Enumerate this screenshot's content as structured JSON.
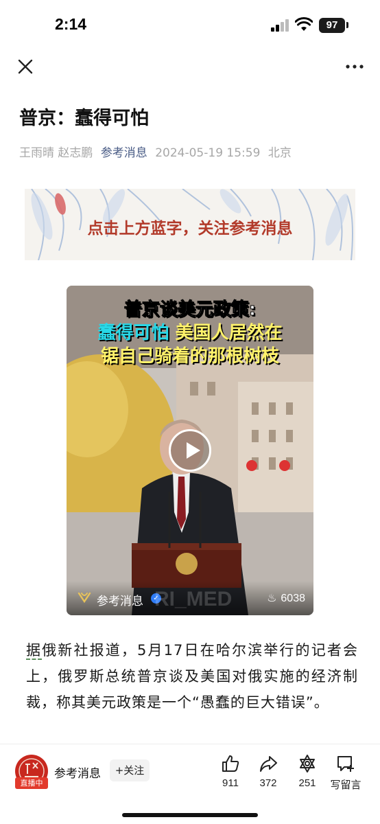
{
  "status_bar": {
    "time": "2:14",
    "battery": "97"
  },
  "nav": {
    "close_icon": "close-icon",
    "more_icon": "more-horizontal-icon"
  },
  "article": {
    "title": "普京：蠢得可怕",
    "authors": "王雨晴 赵志鹏",
    "source": "参考消息",
    "datetime": "2024-05-19 15:59",
    "location": "北京",
    "banner_text": "点击上方蓝字，关注参考消息",
    "paragraph_link_word": "据",
    "paragraph": "俄新社报道，5月17日在哈尔滨举行的记者会上，俄罗斯总统普京谈及美国对俄实施的经济制裁，称其美元政策是一个“愚蠢的巨大错误”。"
  },
  "video": {
    "headline_line1": "普京谈美元政策:",
    "headline_line2a": "蠢得可怕",
    "headline_line2b": "美国人居然在",
    "headline_line3": "锯自己骑着的那根树枝",
    "channel": "参考消息",
    "watermark": "RI_MED",
    "heat_count": "6038"
  },
  "bottom_bar": {
    "account_name": "参考消息",
    "live_badge": "直播中",
    "follow_label": "+关注",
    "like_count": "911",
    "share_count": "372",
    "collect_count": "251",
    "comment_label": "写留言"
  },
  "colors": {
    "accent_link": "#4a5c86",
    "live_red": "#e23a2c",
    "banner_red": "#b23a2a"
  }
}
